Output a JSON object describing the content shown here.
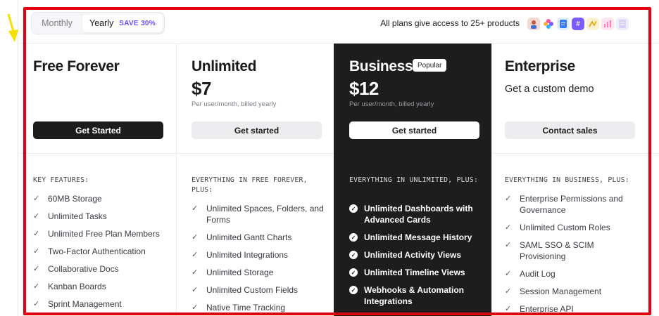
{
  "billing_toggle": {
    "monthly_label": "Monthly",
    "yearly_label": "Yearly",
    "save_label": "SAVE 30%",
    "selected": "Yearly"
  },
  "header": {
    "access_text": "All plans give access to 25+ products",
    "app_icons": [
      {
        "name": "avatar-icon",
        "color": "#f29b8f"
      },
      {
        "name": "clickup-flower-icon",
        "color": "#ff5a7a"
      },
      {
        "name": "docs-icon",
        "color": "#2f7cf6"
      },
      {
        "name": "hashtag-icon",
        "color": "#7b5cff"
      },
      {
        "name": "whiteboard-icon",
        "color": "#f5c542"
      },
      {
        "name": "dashboard-icon",
        "color": "#ff8fb3"
      },
      {
        "name": "forms-icon",
        "color": "#c9c3f5"
      }
    ]
  },
  "plans": [
    {
      "name": "Free Forever",
      "button": "Get Started",
      "features_heading": "KEY FEATURES:",
      "features": [
        "60MB Storage",
        "Unlimited Tasks",
        "Unlimited Free Plan Members",
        "Two-Factor Authentication",
        "Collaborative Docs",
        "Kanban Boards",
        "Sprint Management"
      ]
    },
    {
      "name": "Unlimited",
      "price": "$7",
      "price_sub": "Per user/month, billed yearly",
      "button": "Get started",
      "features_heading": "EVERYTHING IN FREE FOREVER, PLUS:",
      "features": [
        "Unlimited Spaces, Folders, and Forms",
        "Unlimited Gantt Charts",
        "Unlimited Integrations",
        "Unlimited Storage",
        "Unlimited Custom Fields",
        "Native Time Tracking"
      ]
    },
    {
      "name": "Business",
      "badge": "Popular",
      "price": "$12",
      "price_sub": "Per user/month, billed yearly",
      "button": "Get started",
      "features_heading": "EVERYTHING IN UNLIMITED, PLUS:",
      "features": [
        "Unlimited Dashboards with Advanced Cards",
        "Unlimited Message History",
        "Unlimited Activity Views",
        "Unlimited Timeline Views",
        "Webhooks & Automation Integrations"
      ]
    },
    {
      "name": "Enterprise",
      "demo": "Get a custom demo",
      "button": "Contact sales",
      "features_heading": "EVERYTHING IN BUSINESS, PLUS:",
      "features": [
        "Enterprise Permissions and Governance",
        "Unlimited Custom Roles",
        "SAML SSO & SCIM Provisioning",
        "Audit Log",
        "Session Management",
        "Enterprise API"
      ]
    }
  ]
}
